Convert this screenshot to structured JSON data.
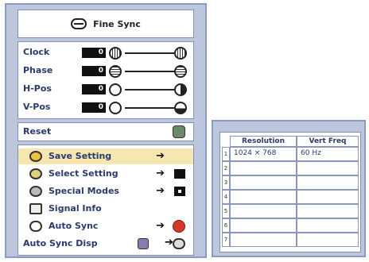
{
  "osd": {
    "title": "Fine Sync",
    "sliders": [
      {
        "label": "Clock",
        "value": "0"
      },
      {
        "label": "Phase",
        "value": "0"
      },
      {
        "label": "H-Pos",
        "value": "0"
      },
      {
        "label": "V-Pos",
        "value": "0"
      }
    ],
    "reset_label": "Reset",
    "menu": {
      "save_setting": "Save Setting",
      "select_setting": "Select Setting",
      "special_modes": "Special Modes",
      "signal_info": "Signal Info",
      "auto_sync": "Auto Sync",
      "auto_sync_disp": "Auto Sync Disp",
      "arrow": "➔"
    }
  },
  "resolution_table": {
    "headers": {
      "resolution": "Resolution",
      "vert_freq": "Vert Freq"
    },
    "rows": [
      {
        "num": "1",
        "resolution": "1024 × 768",
        "vert_freq": "60  Hz"
      },
      {
        "num": "2",
        "resolution": "",
        "vert_freq": ""
      },
      {
        "num": "3",
        "resolution": "",
        "vert_freq": ""
      },
      {
        "num": "4",
        "resolution": "",
        "vert_freq": ""
      },
      {
        "num": "5",
        "resolution": "",
        "vert_freq": ""
      },
      {
        "num": "6",
        "resolution": "",
        "vert_freq": ""
      },
      {
        "num": "7",
        "resolution": "",
        "vert_freq": ""
      }
    ]
  }
}
